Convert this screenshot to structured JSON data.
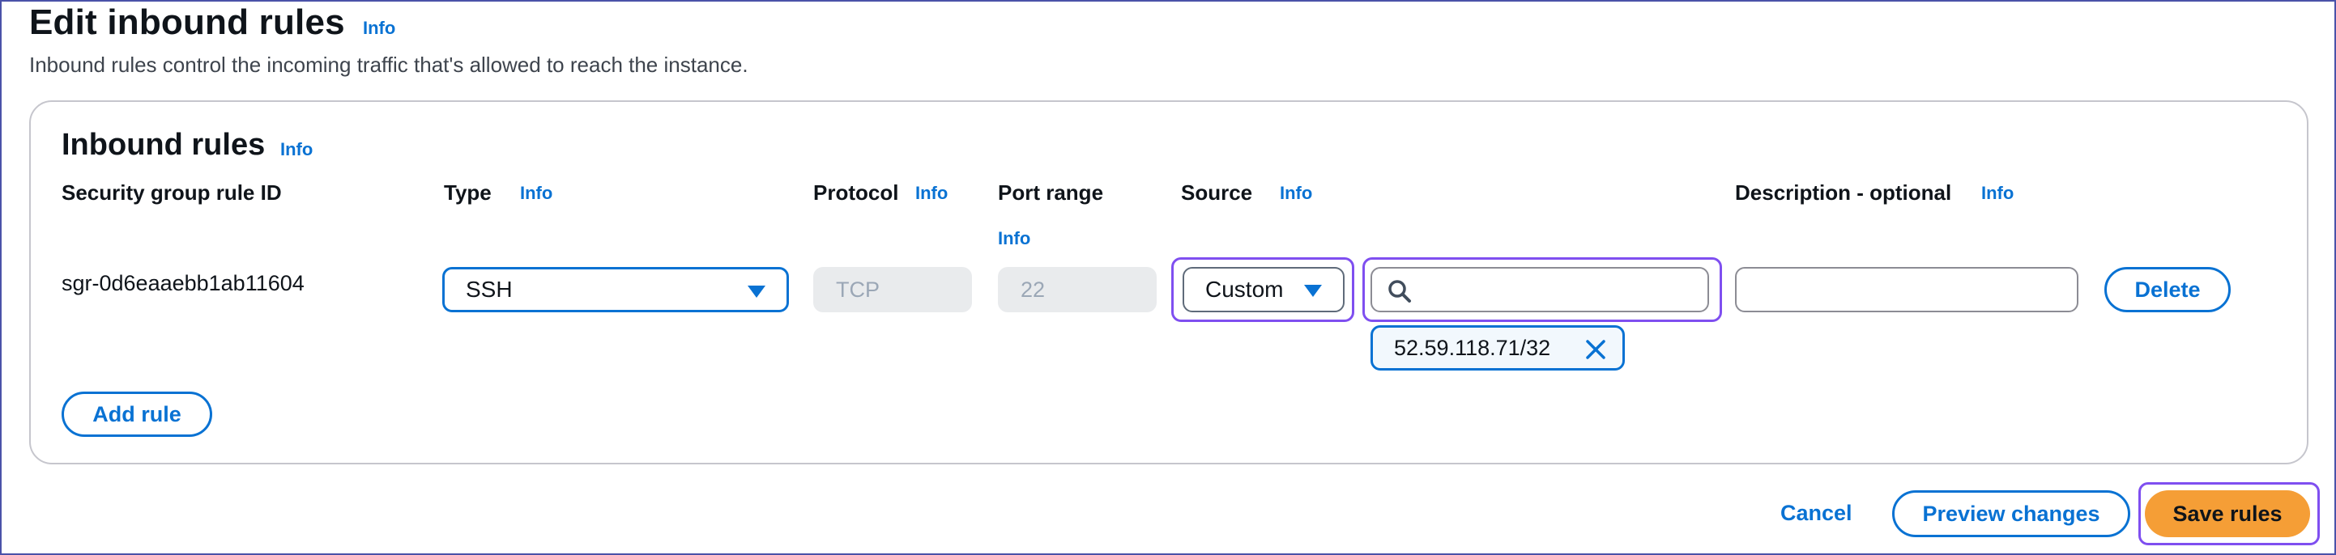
{
  "header": {
    "title": "Edit inbound rules",
    "info": "Info",
    "description": "Inbound rules control the incoming traffic that's allowed to reach the instance."
  },
  "panel": {
    "title": "Inbound rules",
    "info": "Info",
    "columns": {
      "rule_id": "Security group rule ID",
      "type": "Type",
      "protocol": "Protocol",
      "port_range": "Port range",
      "source": "Source",
      "description": "Description - optional",
      "info": "Info"
    },
    "rule": {
      "id": "sgr-0d6eaaebb1ab11604",
      "type": "SSH",
      "protocol": "TCP",
      "port": "22",
      "source_type": "Custom",
      "source_search_value": "",
      "source_token": "52.59.118.71/32",
      "description_value": "",
      "delete_label": "Delete"
    },
    "add_rule_label": "Add rule"
  },
  "footer": {
    "cancel": "Cancel",
    "preview": "Preview changes",
    "save": "Save rules"
  },
  "colors": {
    "accent": "#0972d3",
    "focus": "#7f4ff0",
    "primary_button": "#f59e36"
  },
  "icons": {
    "search": "search-icon",
    "dismiss": "close-icon",
    "dropdown": "caret-down-icon"
  }
}
